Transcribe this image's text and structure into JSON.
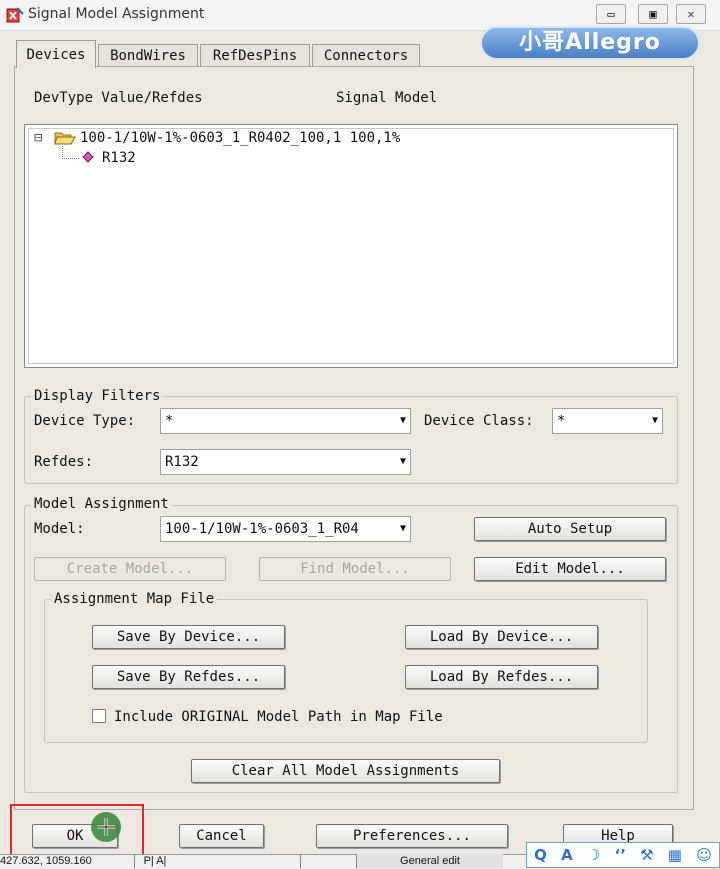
{
  "window": {
    "title": "Signal Model Assignment",
    "min_glyph": "▭",
    "max_glyph": "▣",
    "close_glyph": "✕"
  },
  "logo_text": "小哥Allegro",
  "tabs": [
    {
      "label": "Devices"
    },
    {
      "label": "BondWires"
    },
    {
      "label": "RefDesPins"
    },
    {
      "label": "Connectors"
    }
  ],
  "list_headers": {
    "devtype": "DevType Value/Refdes",
    "signal_model": "Signal Model"
  },
  "tree": {
    "collapse_glyph": "⊟",
    "device": "100-1/10W-1%-0603_1_R0402_100,1 100,1%",
    "refdes": "R132"
  },
  "display_filters": {
    "title": "Display Filters",
    "device_type_label": "Device Type:",
    "device_type_value": "*",
    "device_class_label": "Device Class:",
    "device_class_value": "*",
    "refdes_label": "Refdes:",
    "refdes_value": "R132"
  },
  "model_assignment": {
    "title": "Model Assignment",
    "model_label": "Model:",
    "model_value": "100-1/10W-1%-0603_1_R04",
    "auto_setup": "Auto Setup",
    "create_model": "Create Model...",
    "find_model": "Find Model...",
    "edit_model": "Edit Model..."
  },
  "map_file": {
    "title": "Assignment Map File",
    "save_by_device": "Save By Device...",
    "load_by_device": "Load By Device...",
    "save_by_refdes": "Save By Refdes...",
    "load_by_refdes": "Load By Refdes...",
    "include_original": "Include ORIGINAL Model Path in Map File"
  },
  "clear_all": "Clear All Model Assignments",
  "bottom_buttons": {
    "ok": "OK",
    "cancel": "Cancel",
    "preferences": "Preferences...",
    "help": "Help"
  },
  "status_bar": {
    "coords": "427.632, 1059.160",
    "mode_short": "P| A|",
    "mode": "General edit"
  },
  "tray_icons": [
    "Q",
    "A",
    "☽",
    "‘’",
    "⚒",
    "▦",
    "☺"
  ],
  "colors": {
    "highlight_box": "#e8262d",
    "cursor_green": "#3f8a3f"
  }
}
